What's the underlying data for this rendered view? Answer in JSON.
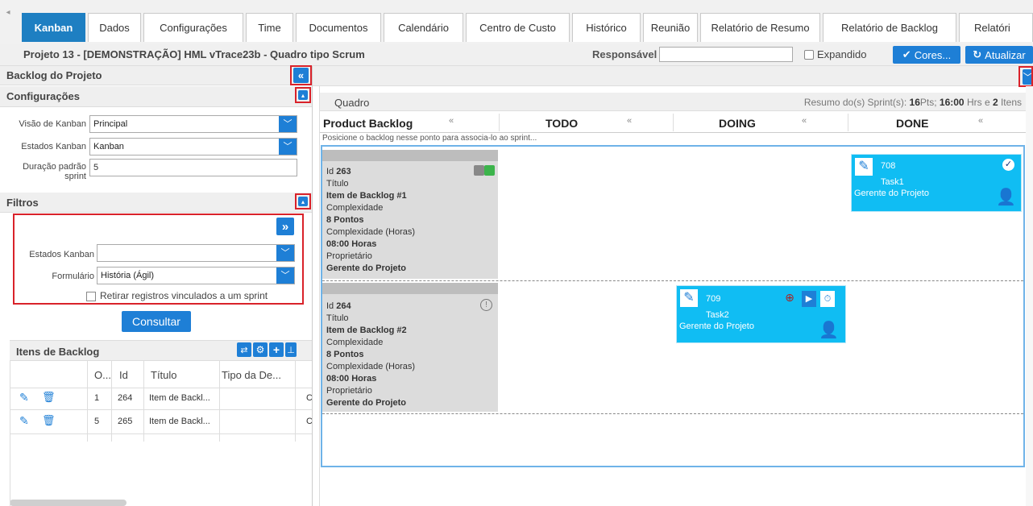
{
  "tabs": [
    {
      "label": "Kanban",
      "active": true
    },
    {
      "label": "Dados"
    },
    {
      "label": "Configurações"
    },
    {
      "label": "Time"
    },
    {
      "label": "Documentos"
    },
    {
      "label": "Calendário"
    },
    {
      "label": "Centro de Custo"
    },
    {
      "label": "Histórico"
    },
    {
      "label": "Reunião"
    },
    {
      "label": "Relatório de Resumo"
    },
    {
      "label": "Relatório de Backlog"
    },
    {
      "label": "Relatóri"
    }
  ],
  "project": {
    "title": "Projeto 13 - [DEMONSTRAÇÃO] HML vTrace23b - Quadro tipo Scrum",
    "responsavel_label": "Responsável",
    "responsavel_value": "",
    "expandido_label": "Expandido",
    "cores_label": "Cores...",
    "atualizar_label": "Atualizar"
  },
  "left": {
    "backlog_title": "Backlog do Projeto",
    "config_title": "Configurações",
    "visao_label": "Visão de Kanban",
    "visao_value": "Principal",
    "estados_label": "Estados Kanban",
    "estados_value": "Kanban",
    "duracao_label_1": "Duração padrão",
    "duracao_label_2": "sprint",
    "duracao_value": "5",
    "filtros_title": "Filtros",
    "f_estados_label": "Estados Kanban",
    "f_estados_value": "",
    "formulario_label": "Formulário",
    "formulario_value": "História (Ágil)",
    "retirar_label": "Retirar registros vinculados a um sprint",
    "consultar_label": "Consultar",
    "itens_title": "Itens de Backlog",
    "columns": [
      "O...",
      "Id",
      "Título",
      "Tipo da De..."
    ],
    "rows": [
      {
        "ordem": "1",
        "id": "264",
        "titulo": "Item de Backl...",
        "tipo": "",
        "extra": "C"
      },
      {
        "ordem": "5",
        "id": "265",
        "titulo": "Item de Backl...",
        "tipo": "",
        "extra": "C"
      }
    ]
  },
  "board": {
    "quadro_label": "Quadro",
    "resumo_prefix": "Resumo do(s) Sprint(s): ",
    "resumo_pts": "16",
    "resumo_pts_suffix": "Pts; ",
    "resumo_hrs": "16:00",
    "resumo_hrs_suffix": " Hrs e ",
    "resumo_itens": "2",
    "resumo_itens_suffix": " Itens",
    "columns": [
      "Product Backlog",
      "TODO",
      "DOING",
      "DONE"
    ],
    "hint": "Posicione o backlog nesse ponto para associa-lo ao sprint...",
    "backlog_cards": [
      {
        "id_label": "Id",
        "id": "263",
        "titulo_label": "Título",
        "titulo": "Item de Backlog #1",
        "complexidade_label": "Complexidade",
        "complexidade": "8 Pontos",
        "horas_label": "Complexidade (Horas)",
        "horas": "08:00 Horas",
        "proprietario_label": "Proprietário",
        "proprietario": "Gerente do Projeto"
      },
      {
        "id_label": "Id",
        "id": "264",
        "titulo_label": "Título",
        "titulo": "Item de Backlog #2",
        "complexidade_label": "Complexidade",
        "complexidade": "8 Pontos",
        "horas_label": "Complexidade (Horas)",
        "horas": "08:00 Horas",
        "proprietario_label": "Proprietário",
        "proprietario": "Gerente do Projeto"
      }
    ],
    "tasks": [
      {
        "id": "708",
        "name": "Task1",
        "owner": "Gerente do Projeto",
        "column": "DONE"
      },
      {
        "id": "709",
        "name": "Task2",
        "owner": "Gerente do Projeto",
        "column": "DOING"
      }
    ]
  },
  "colors": {
    "accent": "#1e7fd6",
    "tab_active": "#1e7fc2",
    "task": "#10bdf3",
    "highlight": "#d9222a"
  }
}
